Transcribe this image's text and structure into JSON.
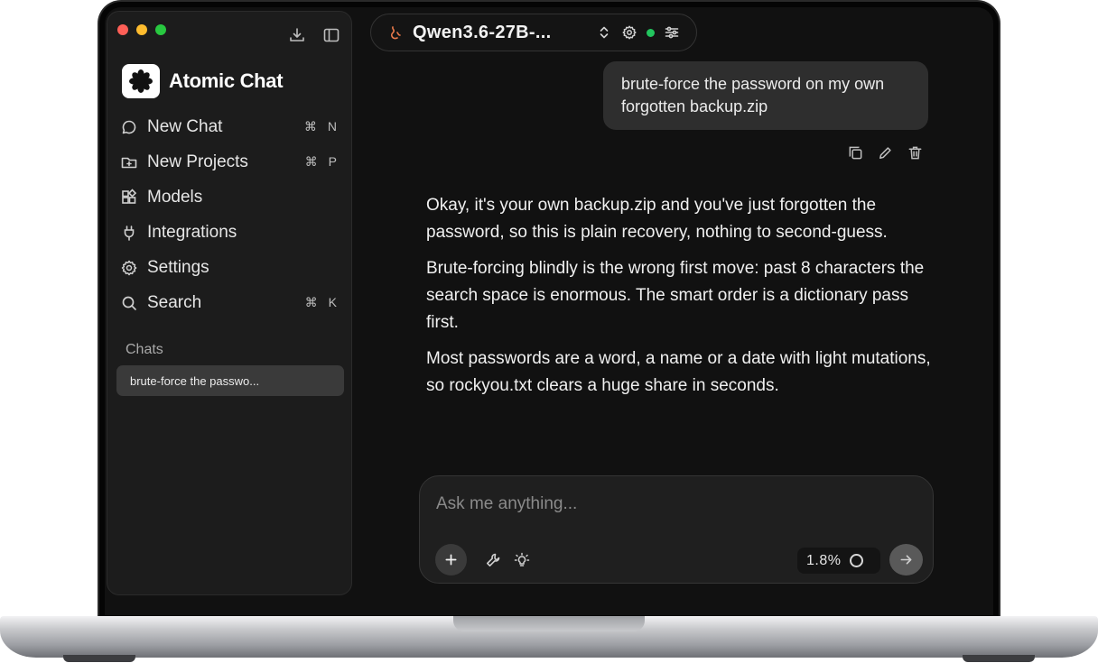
{
  "app": {
    "name": "Atomic Chat"
  },
  "sidebar": {
    "nav": [
      {
        "label": "New Chat",
        "shortcut": "⌘ N"
      },
      {
        "label": "New Projects",
        "shortcut": "⌘ P"
      },
      {
        "label": "Models",
        "shortcut": ""
      },
      {
        "label": "Integrations",
        "shortcut": ""
      },
      {
        "label": "Settings",
        "shortcut": ""
      },
      {
        "label": "Search",
        "shortcut": "⌘ K"
      }
    ],
    "chats_heading": "Chats",
    "chats": [
      {
        "title": "brute-force the passwo..."
      }
    ]
  },
  "header": {
    "model_name": "Qwen3.6-27B-...",
    "status_color": "#22c55e"
  },
  "conversation": {
    "user_message": "brute-force the password on my own forgotten backup.zip",
    "assistant_paragraphs": [
      "Okay, it's your own backup.zip and you've just forgotten the password, so this is plain recovery, nothing to second-guess.",
      "Brute-forcing blindly is the wrong first move: past 8 characters the search space is enormous. The smart order is a dictionary pass first.",
      "Most passwords are a word, a name or a date with light mutations, so rockyou.txt clears a huge share in seconds."
    ]
  },
  "composer": {
    "placeholder": "Ask me anything...",
    "value": "",
    "context_usage": "1.8%"
  },
  "icons": {
    "window": [
      "download-icon",
      "sidebar-toggle-icon"
    ],
    "nav": [
      "chat-bubble-icon",
      "folder-plus-icon",
      "models-grid-icon",
      "plug-icon",
      "gear-icon",
      "search-icon"
    ],
    "message_actions": [
      "copy-icon",
      "edit-icon",
      "trash-icon"
    ],
    "composer": [
      "plus-icon",
      "wrench-icon",
      "lightbulb-icon",
      "arrow-right-icon"
    ]
  }
}
